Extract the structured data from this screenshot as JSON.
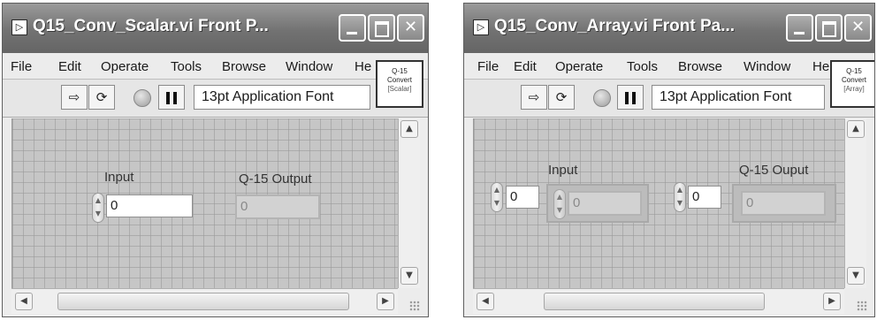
{
  "windows": [
    {
      "title": "Q15_Conv_Scalar.vi Front P...",
      "menu": [
        "File",
        "Edit",
        "Operate",
        "Tools",
        "Browse",
        "Window",
        "He"
      ],
      "font_selector": "13pt Application Font",
      "vi_icon": [
        "Q-15",
        "Convert",
        "[Scalar]"
      ],
      "input_label": "Input",
      "input_value": "0",
      "output_label": "Q-15 Output",
      "output_value": "0"
    },
    {
      "title": "Q15_Conv_Array.vi Front Pa...",
      "menu": [
        "File",
        "Edit",
        "Operate",
        "Tools",
        "Browse",
        "Window",
        "He"
      ],
      "font_selector": "13pt Application Font",
      "vi_icon": [
        "Q-15",
        "Convert",
        "[Array]"
      ],
      "input_label": "Input",
      "input_index": "0",
      "input_value": "0",
      "output_label": "Q-15 Ouput",
      "output_index": "0",
      "output_value": "0"
    }
  ],
  "icons": {
    "titlebar": "labview-vi-icon",
    "window_buttons": [
      "minimize-icon",
      "maximize-icon",
      "close-icon"
    ],
    "toolbar": [
      "run-arrow-icon",
      "run-continuous-icon",
      "abort-stop-icon",
      "pause-icon"
    ]
  },
  "glyphs": {
    "close": "✕",
    "run": "⇨",
    "run_continuous": "⟳",
    "scroll_up": "▲",
    "scroll_down": "▼",
    "scroll_left": "◀",
    "scroll_right": "▶",
    "title_icon": "▷"
  }
}
